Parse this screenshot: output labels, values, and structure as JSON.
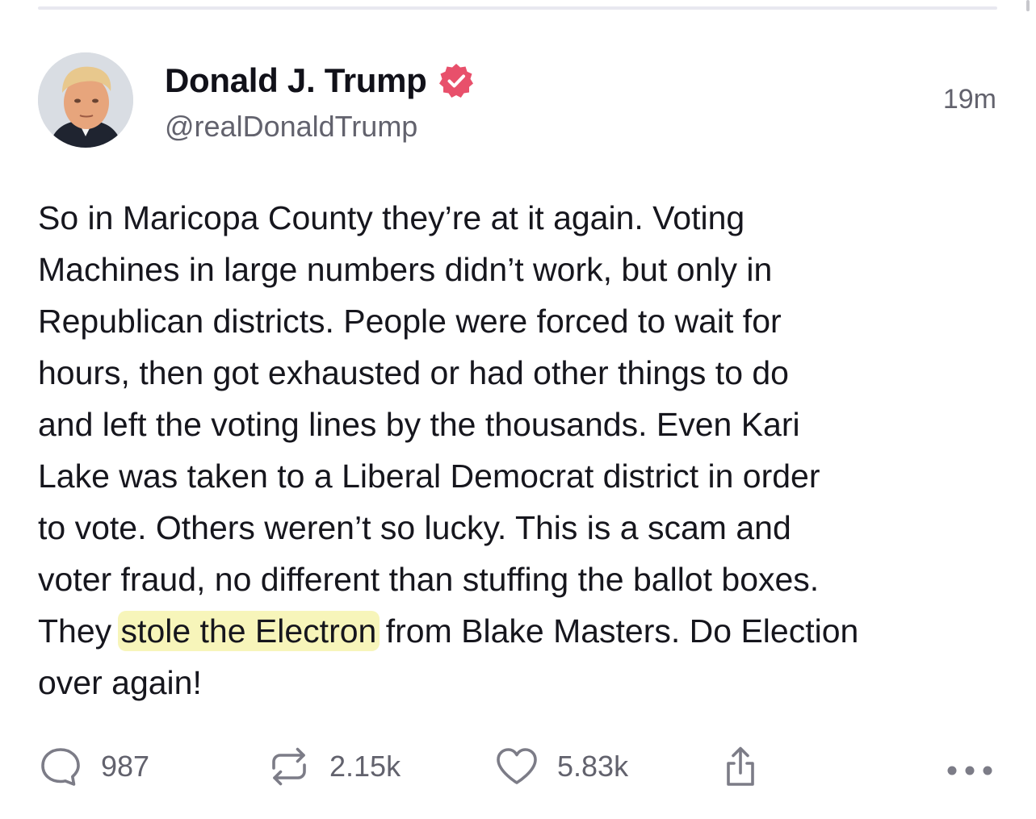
{
  "post": {
    "author": {
      "display_name": "Donald J. Trump",
      "handle": "@realDonaldTrump",
      "verified": true,
      "verified_color": "#e8506b"
    },
    "timestamp": "19m",
    "body_before": "So in Maricopa County they’re at it again. Voting\nMachines in large numbers didn’t work, but only in\nRepublican districts. People were forced to wait for\nhours, then got exhausted or had other things to do\nand left the voting lines by the thousands. Even Kari\nLake was taken to a Liberal Democrat district in order\nto vote. Others weren’t so lucky. This is a scam and\nvoter fraud, no different than stuffing the ballot boxes.\nThey ",
    "body_highlight": "stole the Electron",
    "body_after": " from Blake Masters. Do Election\nover again!",
    "highlight_color": "#f0ec82"
  },
  "actions": {
    "reply": {
      "icon": "reply-icon",
      "count": "987"
    },
    "repost": {
      "icon": "repost-icon",
      "count": "2.15k"
    },
    "like": {
      "icon": "heart-icon",
      "count": "5.83k"
    },
    "share": {
      "icon": "share-icon"
    },
    "more": {
      "icon": "more-icon"
    }
  }
}
